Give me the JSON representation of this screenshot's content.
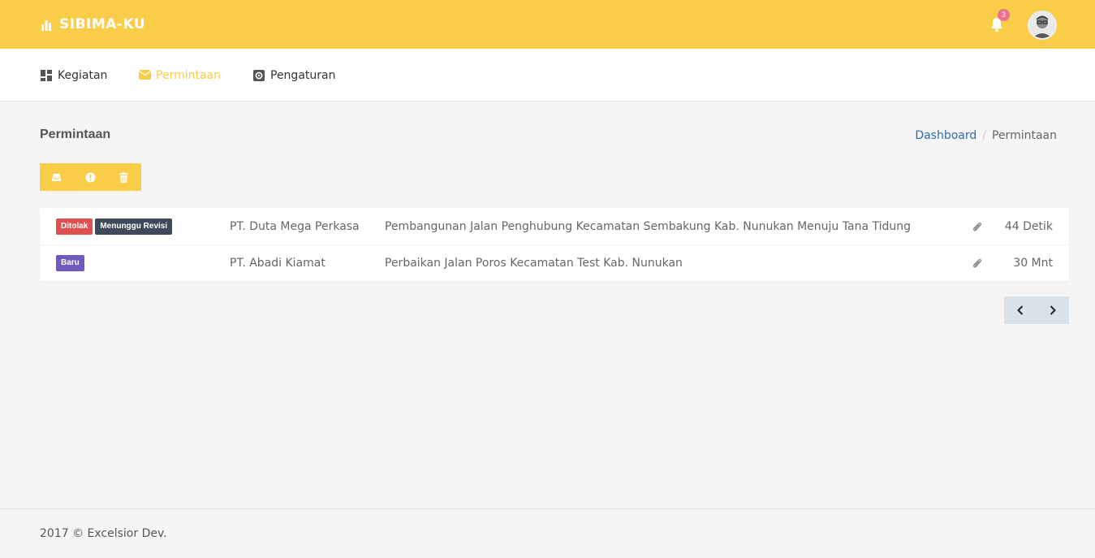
{
  "app": {
    "brand": "SIBIMA-KU",
    "notification_count": "3"
  },
  "nav": {
    "items": [
      {
        "label": "Kegiatan"
      },
      {
        "label": "Permintaan"
      },
      {
        "label": "Pengaturan"
      }
    ]
  },
  "page": {
    "title": "Permintaan"
  },
  "breadcrumb": {
    "home": "Dashboard",
    "current": "Permintaan"
  },
  "requests": [
    {
      "badges": [
        {
          "text": "Ditolak",
          "color": "#e04f4f"
        },
        {
          "text": "Menunggu Revisi",
          "color": "#3e4a59"
        }
      ],
      "company": "PT. Duta Mega Perkasa",
      "title": "Pembangunan Jalan Penghubung Kecamatan Sembakung Kab. Nunukan Menuju Tana Tidung",
      "time": "44 Detik"
    },
    {
      "badges": [
        {
          "text": "Baru",
          "color": "#7159bf"
        }
      ],
      "company": "PT. Abadi Kiamat",
      "title": "Perbaikan Jalan Poros Kecamatan Test Kab. Nunukan",
      "time": "30 Mnt"
    }
  ],
  "footer": {
    "text": "2017 © Excelsior Dev."
  },
  "colors": {
    "accent": "#f9cd48",
    "link": "#3169b1",
    "notification": "#ef6f8c"
  }
}
